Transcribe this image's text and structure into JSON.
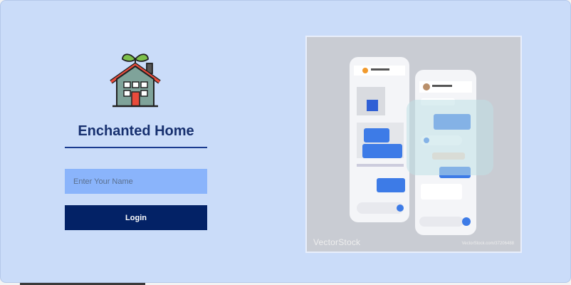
{
  "brand": {
    "title": "Enchanted Home",
    "logo_icon": "house-with-sprout-icon"
  },
  "login_form": {
    "name_placeholder": "Enter Your Name",
    "name_value": "",
    "login_label": "Login"
  },
  "hero_image": {
    "description_icon": "chat-app-phones-illustration",
    "watermark_brand": "VectorStock",
    "watermark_id": "VectorStock.com/37206488"
  },
  "colors": {
    "background": "#cadcf9",
    "title": "#17306f",
    "input_fill": "#8ab4fb",
    "button_fill": "#032266",
    "button_text": "#ffffff"
  }
}
